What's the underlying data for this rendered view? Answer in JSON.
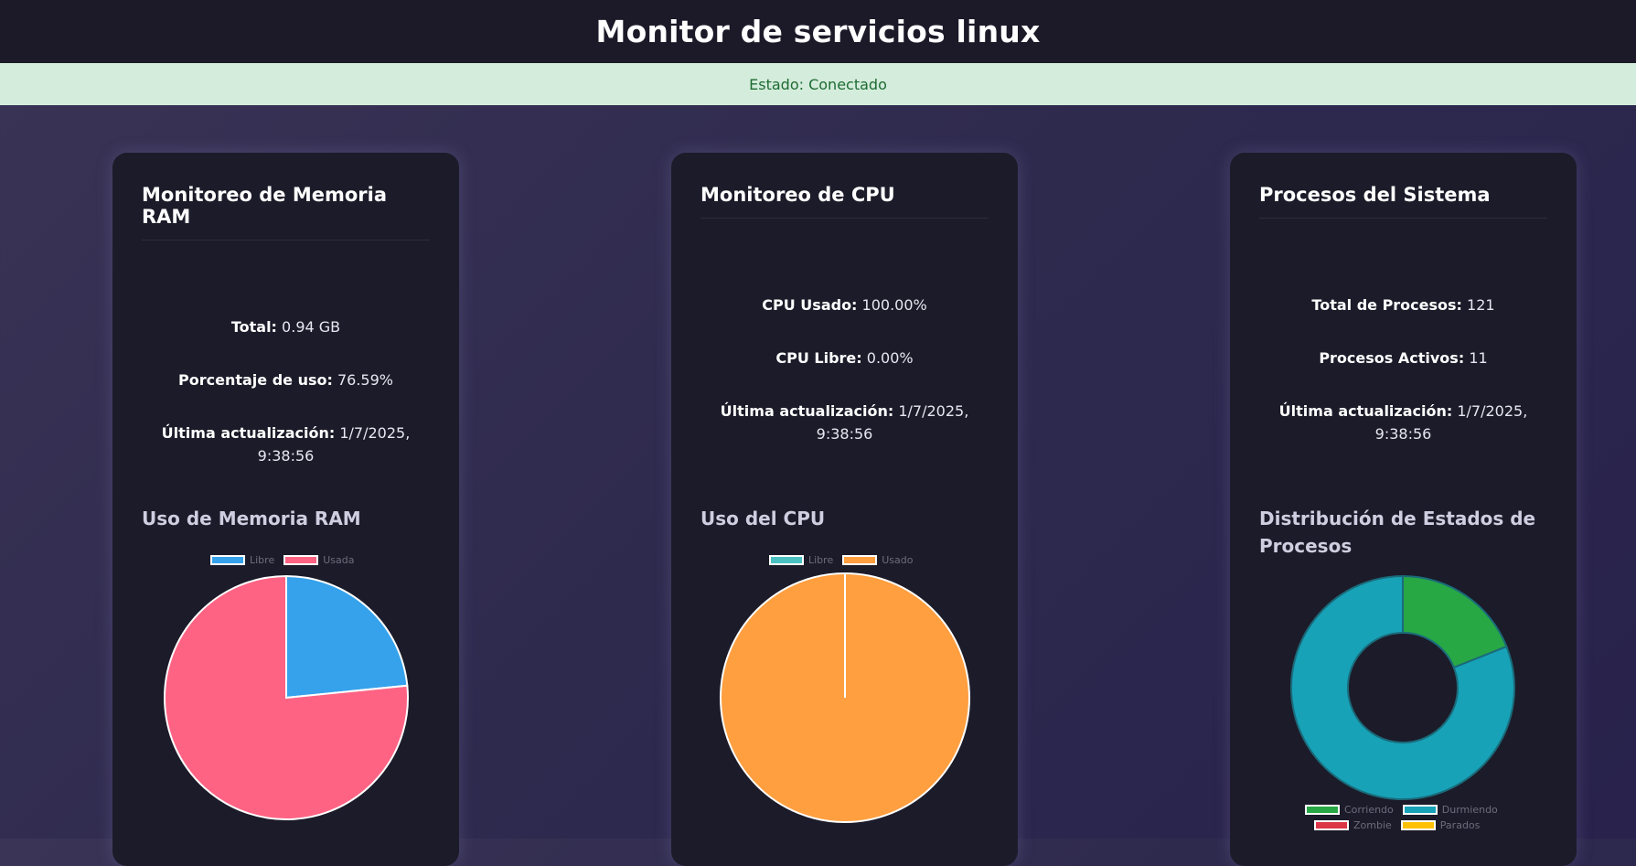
{
  "header": {
    "title": "Monitor de servicios linux"
  },
  "status": {
    "text": "Estado: Conectado"
  },
  "ram": {
    "title": "Monitoreo de Memoria RAM",
    "total_label": "Total:",
    "total_value": "0.94 GB",
    "usage_label": "Porcentaje de uso:",
    "usage_value": "76.59%",
    "updated_label": "Última actualización:",
    "updated_value": "1/7/2025, 9:38:56",
    "chart_title": "Uso de Memoria RAM",
    "legend": [
      {
        "label": "Libre",
        "color": "#36a2eb"
      },
      {
        "label": "Usada",
        "color": "#ff6384"
      }
    ]
  },
  "cpu": {
    "title": "Monitoreo de CPU",
    "used_label": "CPU Usado:",
    "used_value": "100.00%",
    "free_label": "CPU Libre:",
    "free_value": "0.00%",
    "updated_label": "Última actualización:",
    "updated_value": "1/7/2025, 9:38:56",
    "chart_title": "Uso del CPU",
    "legend": [
      {
        "label": "Libre",
        "color": "#4bc0c0"
      },
      {
        "label": "Usado",
        "color": "#ff9f40"
      }
    ]
  },
  "procs": {
    "title": "Procesos del Sistema",
    "total_label": "Total de Procesos:",
    "total_value": "121",
    "active_label": "Procesos Activos:",
    "active_value": "11",
    "updated_label": "Última actualización:",
    "updated_value": "1/7/2025, 9:38:56",
    "chart_title": "Distribución de Estados de Procesos",
    "legend": [
      {
        "label": "Corriendo",
        "color": "#28a745"
      },
      {
        "label": "Durmiendo",
        "color": "#17a2b8"
      },
      {
        "label": "Zombie",
        "color": "#dc3545"
      },
      {
        "label": "Parados",
        "color": "#ffc107"
      }
    ]
  },
  "chart_data": [
    {
      "type": "pie",
      "title": "Uso de Memoria RAM",
      "categories": [
        "Libre",
        "Usada"
      ],
      "values": [
        23.41,
        76.59
      ],
      "colors": [
        "#36a2eb",
        "#ff6384"
      ]
    },
    {
      "type": "pie",
      "title": "Uso del CPU",
      "categories": [
        "Libre",
        "Usado"
      ],
      "values": [
        0,
        100
      ],
      "colors": [
        "#4bc0c0",
        "#ff9f40"
      ]
    },
    {
      "type": "doughnut",
      "title": "Distribución de Estados de Procesos",
      "categories": [
        "Corriendo",
        "Durmiendo",
        "Zombie",
        "Parados"
      ],
      "values": [
        19,
        81,
        0,
        0
      ],
      "colors": [
        "#28a745",
        "#17a2b8",
        "#dc3545",
        "#ffc107"
      ]
    }
  ]
}
